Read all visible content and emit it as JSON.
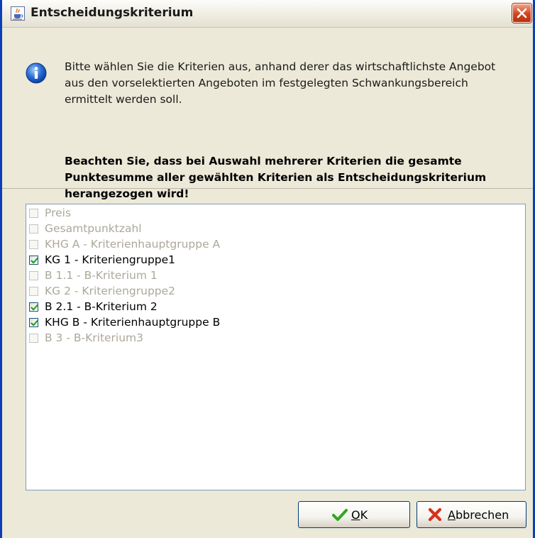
{
  "window": {
    "title": "Entscheidungskriterium",
    "icons": {
      "app": "java-cup-icon",
      "close": "close-icon"
    }
  },
  "info": {
    "icon": "info-icon",
    "text": "Bitte wählen Sie die Kriterien aus, anhand derer das wirtschaftlichste Angebot aus den vorselektierten Angeboten im festgelegten Schwankungsbereich ermittelt werden soll.",
    "bold_text": "Beachten Sie, dass bei Auswahl mehrerer Kriterien die gesamte Punktesumme aller gewählten Kriterien als Entscheidungskriterium herangezogen wird!"
  },
  "criteria": [
    {
      "label": "Preis",
      "checked": false,
      "enabled": false
    },
    {
      "label": "Gesamtpunktzahl",
      "checked": false,
      "enabled": false
    },
    {
      "label": "KHG A - Kriterienhauptgruppe A",
      "checked": false,
      "enabled": false
    },
    {
      "label": "KG 1 - Kriteriengruppe1",
      "checked": true,
      "enabled": true
    },
    {
      "label": "B 1.1 - B-Kriterium 1",
      "checked": false,
      "enabled": false
    },
    {
      "label": "KG 2 - Kriteriengruppe2",
      "checked": false,
      "enabled": false
    },
    {
      "label": "B 2.1 - B-Kriterium 2",
      "checked": true,
      "enabled": true
    },
    {
      "label": "KHG B - Kriterienhauptgruppe B",
      "checked": true,
      "enabled": true
    },
    {
      "label": "B 3 - B-Kriterium3",
      "checked": false,
      "enabled": false
    }
  ],
  "buttons": {
    "ok": {
      "mnemonic": "O",
      "rest": "K",
      "icon": "checkmark-icon"
    },
    "cancel": {
      "mnemonic": "A",
      "rest": "bbrechen",
      "icon": "cancel-x-icon"
    }
  },
  "colors": {
    "accent": "#0a3fb8",
    "check": "#21a121",
    "disabled_text": "#aca899"
  }
}
